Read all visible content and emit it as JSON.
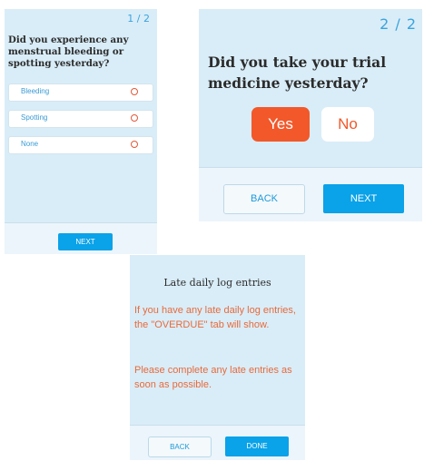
{
  "screen1": {
    "pager": "1 / 2",
    "question": "Did you experience any menstrual bleeding or spotting yesterday?",
    "options": [
      {
        "label": "Bleeding"
      },
      {
        "label": "Spotting"
      },
      {
        "label": "None"
      }
    ],
    "next_label": "NEXT"
  },
  "screen2": {
    "pager": "2 / 2",
    "question": "Did you take your trial medicine yesterday?",
    "yes_label": "Yes",
    "no_label": "No",
    "back_label": "BACK",
    "next_label": "NEXT"
  },
  "screen3": {
    "title": "Late daily log entries",
    "message_1": "If you have any late daily log entries, the \"OVERDUE\" tab will show.",
    "message_2": "Please complete any late entries as soon as possible.",
    "back_label": "BACK",
    "done_label": "DONE"
  },
  "colors": {
    "panel_bg": "#d9edf8",
    "primary": "#0aa2e8",
    "accent": "#f2582a",
    "message_text": "#e86a3a"
  },
  "icons": {
    "option_radio": "radio-unselected-icon"
  }
}
